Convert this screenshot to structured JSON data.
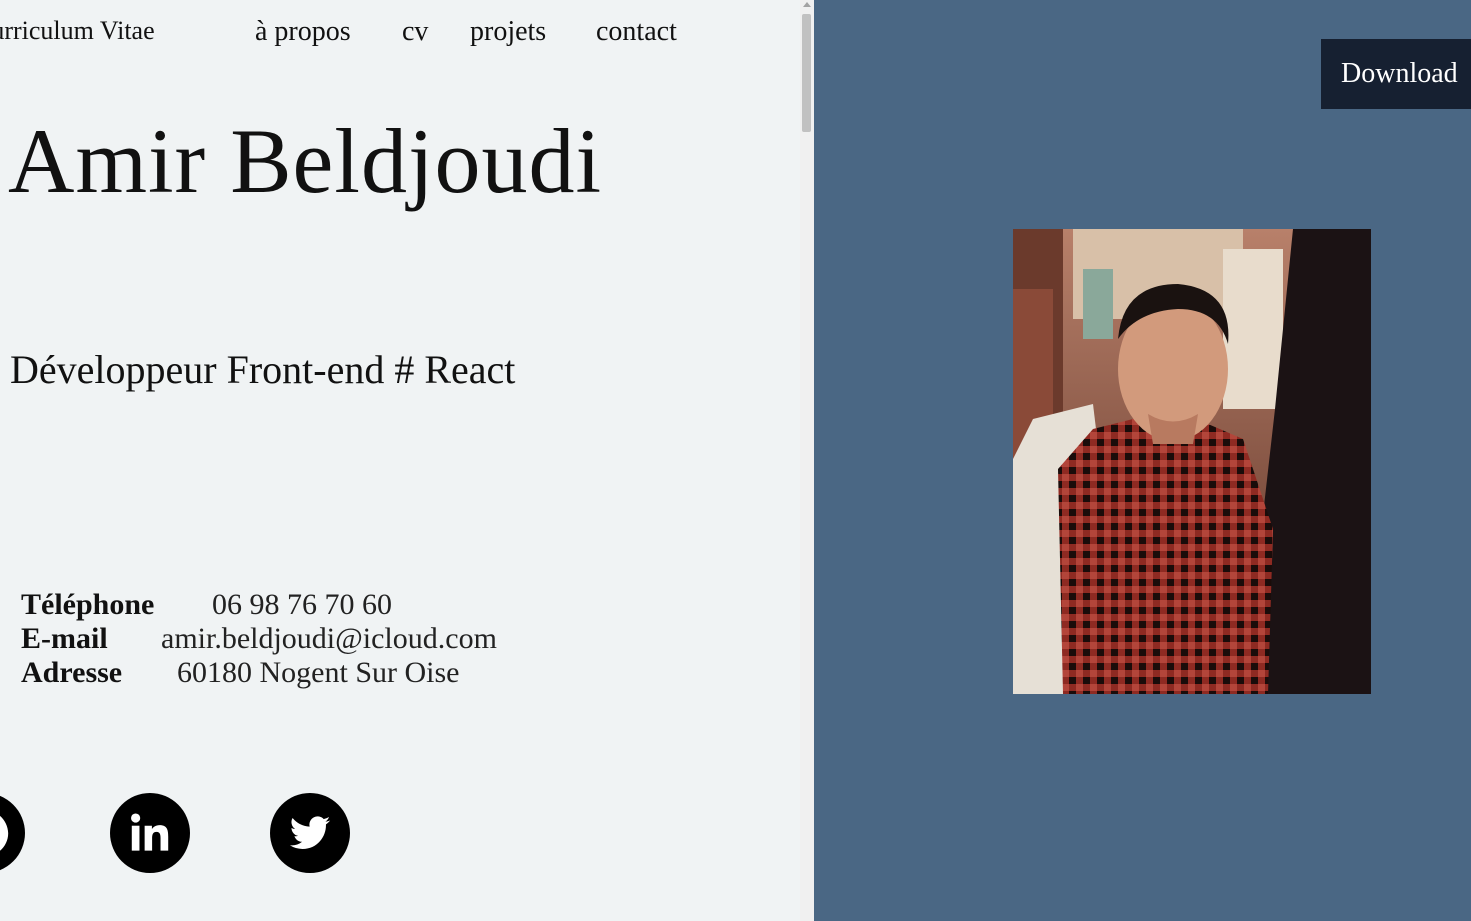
{
  "header": {
    "brand": "Curriculum Vitae",
    "nav": [
      {
        "label": "à propos"
      },
      {
        "label": "cv"
      },
      {
        "label": "projets"
      },
      {
        "label": "contact"
      }
    ]
  },
  "hero": {
    "name": "Amir Beldjoudi",
    "role": "Développeur Front-end # React"
  },
  "contact_info": [
    {
      "label": "Téléphone",
      "value": "06 98 76 70 60"
    },
    {
      "label": "E-mail",
      "value": "amir.beldjoudi@icloud.com"
    },
    {
      "label": "Adresse",
      "value": "60180 Nogent Sur Oise"
    }
  ],
  "social": [
    {
      "icon": "github-icon"
    },
    {
      "icon": "linkedin-icon"
    },
    {
      "icon": "twitter-icon"
    }
  ],
  "sidebar": {
    "download_label": "Download"
  },
  "colors": {
    "left_background": "#f0f3f4",
    "right_background": "#4a6784",
    "download_background": "#162031",
    "text": "#111111"
  }
}
